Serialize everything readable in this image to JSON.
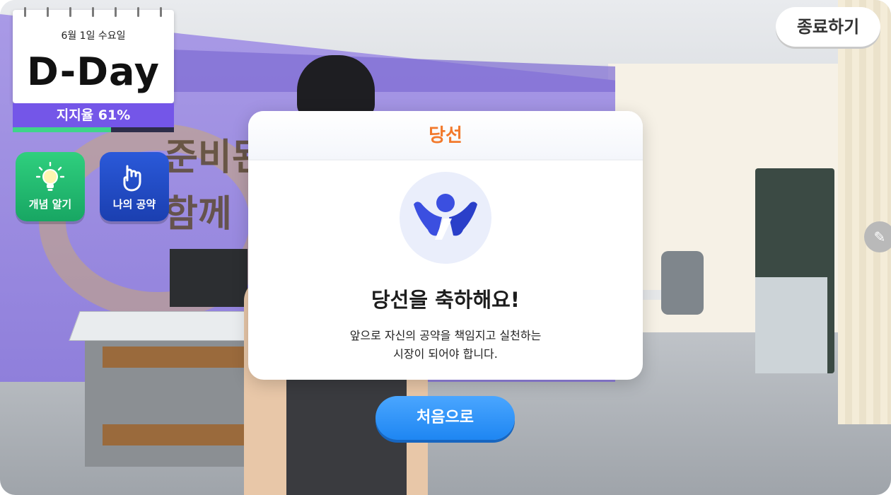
{
  "calendar": {
    "date": "6월 1일 수요일",
    "dday": "D-Day",
    "support_label": "지지율 61%",
    "support_fraction": 0.61
  },
  "side_buttons": {
    "concept_label": "개념 알기",
    "pledge_label": "나의 공약"
  },
  "exit_label": "종료하기",
  "scene": {
    "banner_line1": "준비된",
    "banner_line2": "함께"
  },
  "modal": {
    "title": "당선",
    "heading": "당선을 축하해요!",
    "desc_line1": "앞으로 자신의 공약을 책임지고 실천하는",
    "desc_line2": "시장이 되어야 합니다."
  },
  "restart_label": "처음으로",
  "colors": {
    "accent_orange": "#f2792c",
    "support_purple": "#7456e8",
    "progress_green": "#3fd48a",
    "primary_blue": "#1e86f2",
    "concept_green": "#18a663",
    "pledge_blue": "#1b3fb0"
  },
  "icons": {
    "concept": "lightbulb-icon",
    "pledge": "hand-pointing-icon",
    "modal": "celebrating-person-icon",
    "side": "pencil-icon"
  }
}
